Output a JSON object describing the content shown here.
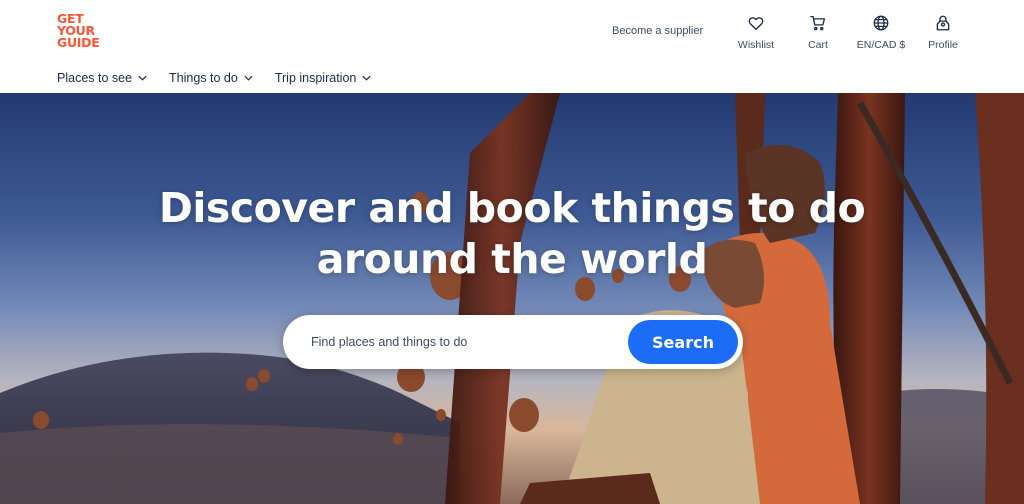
{
  "logo": {
    "line1": "GET",
    "line2": "YOUR",
    "line3": "GUIDE"
  },
  "header": {
    "supplier_link": "Become a supplier",
    "actions": [
      {
        "label": "Wishlist",
        "icon": "heart-icon"
      },
      {
        "label": "Cart",
        "icon": "cart-icon"
      },
      {
        "label": "EN/CAD $",
        "icon": "globe-icon"
      },
      {
        "label": "Profile",
        "icon": "profile-icon"
      }
    ]
  },
  "nav": {
    "items": [
      {
        "label": "Places to see"
      },
      {
        "label": "Things to do"
      },
      {
        "label": "Trip inspiration"
      }
    ]
  },
  "hero": {
    "title_line1": "Discover and book things to do",
    "title_line2": "around the world",
    "search_placeholder": "Find places and things to do",
    "search_button": "Search"
  },
  "colors": {
    "brand": "#ff5533",
    "accent": "#1c6cf5",
    "text": "#1a2b49"
  }
}
